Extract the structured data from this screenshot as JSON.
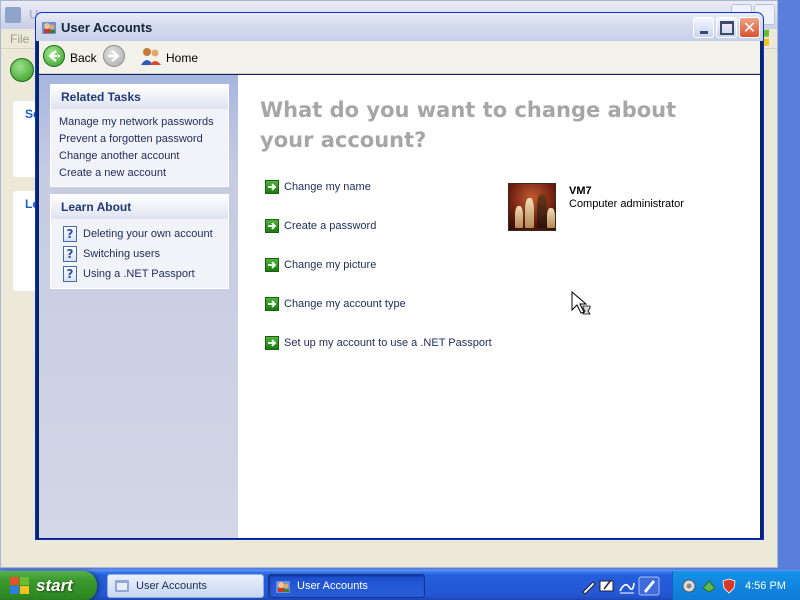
{
  "background_window": {
    "title": "Us",
    "menu_file": "File",
    "panel1_label": "Se",
    "panel2_label": "Le"
  },
  "window": {
    "title": "User Accounts"
  },
  "nav": {
    "back": "Back",
    "home": "Home"
  },
  "sidebar": {
    "related_tasks": {
      "title": "Related Tasks",
      "items": [
        "Manage my network passwords",
        "Prevent a forgotten password",
        "Change another account",
        "Create a new account"
      ]
    },
    "learn_about": {
      "title": "Learn About",
      "items": [
        "Deleting your own account",
        "Switching users",
        "Using a .NET Passport"
      ]
    }
  },
  "main": {
    "heading": "What do you want to change about your account?",
    "actions": [
      "Change my name",
      "Create a password",
      "Change my picture",
      "Change my account type",
      "Set up my account to use a .NET Passport"
    ],
    "user": {
      "name": "VM7",
      "role": "Computer administrator"
    }
  },
  "taskbar": {
    "start": "start",
    "buttons": [
      "User Accounts",
      "User Accounts"
    ],
    "clock": "4:56 PM"
  },
  "colors": {
    "xp_blue": "#0831d9",
    "start_green": "#3b9a2e",
    "link_text": "#1d2b5c",
    "heading_gray": "#a6a6a6"
  }
}
